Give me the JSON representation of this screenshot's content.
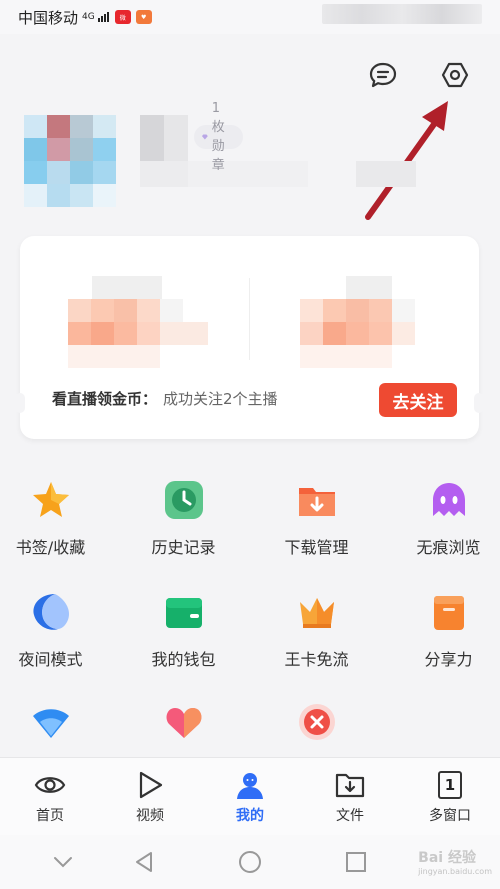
{
  "status_bar": {
    "carrier": "中国移动",
    "network": "4G",
    "app_badges": [
      {
        "name": "weibo",
        "color": "#e7272d"
      },
      {
        "name": "app",
        "color": "#f2793b"
      }
    ]
  },
  "header": {
    "icons": [
      "message-icon",
      "settings-icon"
    ],
    "badge_text": "1枚 勋章"
  },
  "coin_card": {
    "title": "看直播领金币：",
    "desc": "成功关注2个主播",
    "button": "去关注"
  },
  "features": [
    {
      "label": "书签/收藏",
      "icon": "star-icon"
    },
    {
      "label": "历史记录",
      "icon": "clock-icon"
    },
    {
      "label": "下载管理",
      "icon": "download-folder-icon"
    },
    {
      "label": "无痕浏览",
      "icon": "ghost-icon"
    },
    {
      "label": "夜间模式",
      "icon": "moon-icon"
    },
    {
      "label": "我的钱包",
      "icon": "wallet-icon"
    },
    {
      "label": "王卡免流",
      "icon": "crown-icon"
    },
    {
      "label": "分享力",
      "icon": "gift-icon"
    },
    {
      "label": "",
      "icon": "wifi-icon"
    },
    {
      "label": "",
      "icon": "heart-icon"
    },
    {
      "label": "",
      "icon": "close-circle-icon"
    }
  ],
  "tabbar": {
    "tabs": [
      {
        "label": "首页",
        "icon": "eye-icon"
      },
      {
        "label": "视频",
        "icon": "play-icon"
      },
      {
        "label": "我的",
        "icon": "user-icon"
      },
      {
        "label": "文件",
        "icon": "file-download-icon"
      },
      {
        "label": "多窗口",
        "icon": "window-count-icon",
        "count": "1"
      }
    ],
    "active": "我的"
  },
  "watermark": {
    "text": "Bai 经验",
    "sub": "jingyan.baidu.com"
  },
  "colors": {
    "accent_blue": "#2f6df6",
    "follow_red": "#ee4a32",
    "arrow_red": "#b0202a"
  }
}
